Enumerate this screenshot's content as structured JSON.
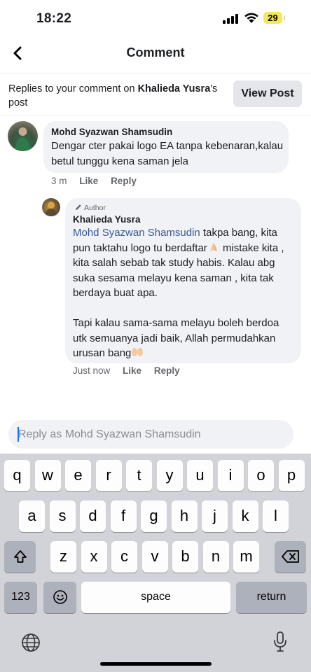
{
  "status_bar": {
    "time": "18:22",
    "battery": "29"
  },
  "nav": {
    "title": "Comment"
  },
  "replies_header": {
    "prefix": "Replies to your comment on ",
    "post_owner": "Khalieda Yusra",
    "suffix": "'s post",
    "view_post_label": "View Post"
  },
  "comment": {
    "author": "Mohd Syazwan Shamsudin",
    "text": "Dengar cter pakai logo EA tanpa kebenaran,kalau betul tunggu kena saman jela",
    "time": "3 m",
    "like_label": "Like",
    "reply_label": "Reply"
  },
  "reply": {
    "badge": "Author",
    "author": "Khalieda Yusra",
    "mention": "Mohd Syazwan Shamsudin",
    "text_part1": " takpa bang, kita pun taktahu logo tu berdaftar",
    "text_part2": " mistake kita , kita salah sebab tak study habis. Kalau abg suka sesama melayu kena saman , kita tak berdaya buat apa.",
    "text_para2": "Tapi kalau sama-sama melayu boleh berdoa utk semuanya jadi baik, Allah permudahkan urusan bang",
    "time": "Just now",
    "like_label": "Like",
    "reply_label": "Reply",
    "emoji_1": "folded-hands-emoji",
    "emoji_2": "open-hands-emoji"
  },
  "reply_input": {
    "placeholder": "Reply as Mohd Syazwan Shamsudin"
  },
  "keyboard": {
    "row1": [
      "q",
      "w",
      "e",
      "r",
      "t",
      "y",
      "u",
      "i",
      "o",
      "p"
    ],
    "row2": [
      "a",
      "s",
      "d",
      "f",
      "g",
      "h",
      "j",
      "k",
      "l"
    ],
    "row3": [
      "z",
      "x",
      "c",
      "v",
      "b",
      "n",
      "m"
    ],
    "numbers_label": "123",
    "space_label": "space",
    "return_label": "return",
    "icons": [
      "shift-icon",
      "backspace-icon",
      "emoji-icon",
      "globe-icon",
      "microphone-icon"
    ]
  },
  "colors": {
    "accent": "#1877f2",
    "mention": "#385898",
    "bubble": "#f0f2f5",
    "keyboard_bg": "#d1d3d9"
  }
}
